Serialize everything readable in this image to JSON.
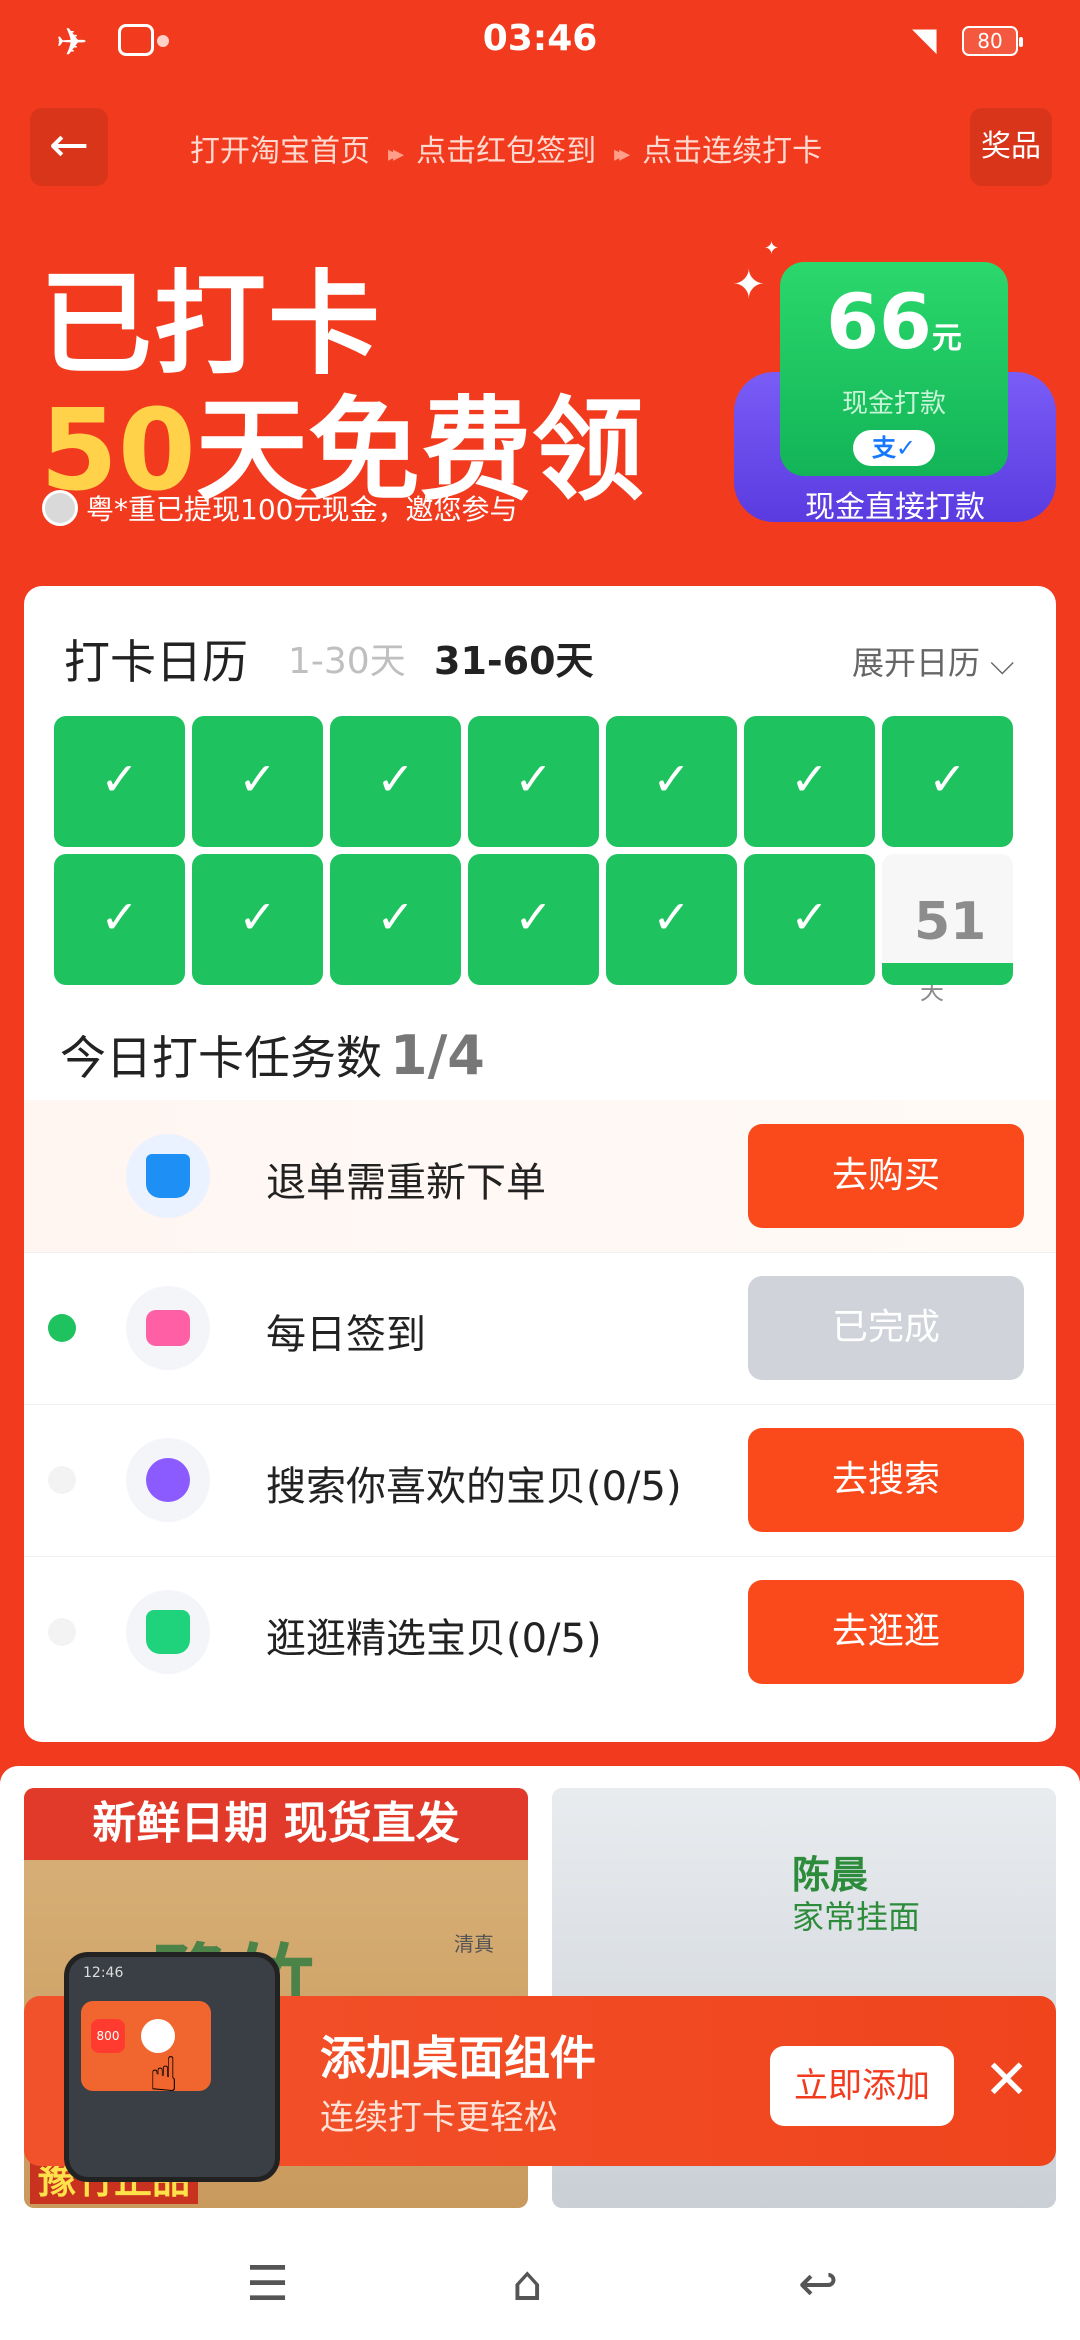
{
  "status_bar": {
    "time": "03:46",
    "battery": "80"
  },
  "header": {
    "back_icon": "←",
    "steps": [
      "打开淘宝首页",
      "点击红包签到",
      "点击连续打卡"
    ],
    "step_arrow": "▸▸",
    "prize_label": "奖品"
  },
  "hero": {
    "line1": "已打卡",
    "days": "50",
    "line2_rest": "天免费领",
    "proof_text": "粤*重已提现100元现金，邀您参与",
    "cash_amount": "66",
    "cash_unit": "元",
    "cash_sub": "现金打款",
    "cash_caption": "现金直接打款",
    "pay_badge": "支✓"
  },
  "calendar": {
    "title": "打卡日历",
    "tab_1": "1-30天",
    "tab_2": "31-60天",
    "expand_label": "展开日历 ⌵",
    "checked_days": 13,
    "check_mark": "✓",
    "today_number": "51",
    "today_unit": "天"
  },
  "tasks": {
    "header_label": "今日打卡任务数",
    "count": "1/4",
    "items": [
      {
        "name": "退单需重新下单",
        "button": "去购买",
        "icon": "shopping-basket-icon"
      },
      {
        "name": "每日签到",
        "button": "已完成",
        "icon": "card-icon"
      },
      {
        "name": "搜索你喜欢的宝贝(0/5)",
        "button": "去搜索",
        "icon": "heart-search-icon"
      },
      {
        "name": "逛逛精选宝贝(0/5)",
        "button": "去逛逛",
        "icon": "shopping-bag-icon"
      }
    ]
  },
  "feed": {
    "product_1_banner": "新鲜日期 现货直发",
    "product_1_text": "豫竹",
    "product_1_tag": "清真",
    "product_1_bottom": "豫竹正品",
    "product_2_brand": "陈晨",
    "product_2_sub": "家常挂面"
  },
  "widget_popup": {
    "phone_time": "12:46",
    "mini_value": "800",
    "title": "添加桌面组件",
    "subtitle": "连续打卡更轻松",
    "add_button": "立即添加",
    "close_icon": "✕"
  },
  "nav_bar": {
    "menu_icon": "☰",
    "home_icon": "⌂",
    "back_icon": "↩"
  },
  "colors": {
    "brand_red": "#f23b1e",
    "check_green": "#1ec25e",
    "button_orange": "#fa4a1c",
    "gold": "#ffd24a"
  }
}
